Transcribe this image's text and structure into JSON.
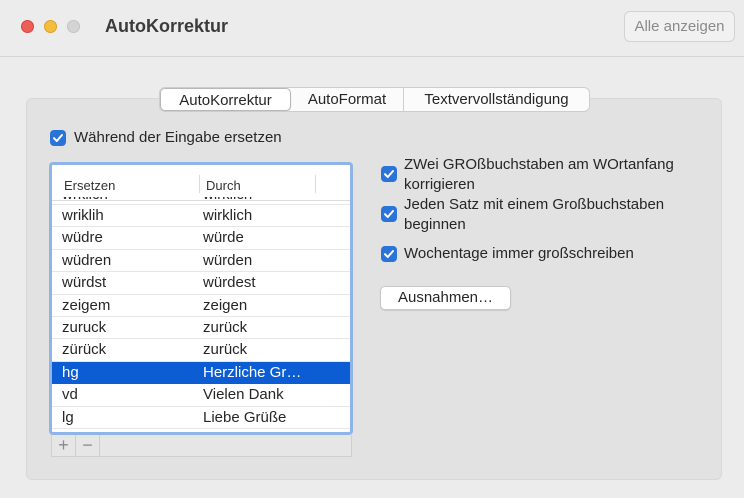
{
  "window": {
    "title": "AutoKorrektur",
    "show_all_label": "Alle anzeigen"
  },
  "tabs": [
    {
      "label": "AutoKorrektur",
      "selected": true
    },
    {
      "label": "AutoFormat",
      "selected": false
    },
    {
      "label": "Textvervollständigung",
      "selected": false
    }
  ],
  "options": {
    "replace_while_typing": {
      "label": "Während der Eingabe ersetzen",
      "checked": true
    },
    "two_capitals": {
      "label_line1": "ZWei GROßbuchstaben am WOrtanfang",
      "label_line2": "korrigieren",
      "checked": true
    },
    "capitalize_sentence": {
      "label_line1": "Jeden Satz mit einem Großbuchstaben",
      "label_line2": "beginnen",
      "checked": true
    },
    "capitalize_weekdays": {
      "label": "Wochentage immer großschreiben",
      "checked": true
    }
  },
  "table": {
    "headers": [
      "Ersetzen",
      "Durch"
    ],
    "partial_row": {
      "replace": "wrklich",
      "with": "wirklich"
    },
    "rows": [
      {
        "replace": "wriklih",
        "with": "wirklich",
        "selected": false
      },
      {
        "replace": "wüdre",
        "with": "würde",
        "selected": false
      },
      {
        "replace": "wüdren",
        "with": "würden",
        "selected": false
      },
      {
        "replace": "würdst",
        "with": "würdest",
        "selected": false
      },
      {
        "replace": "zeigem",
        "with": "zeigen",
        "selected": false
      },
      {
        "replace": "zuruck",
        "with": "zurück",
        "selected": false
      },
      {
        "replace": "zürück",
        "with": "zurück",
        "selected": false
      },
      {
        "replace": "hg",
        "with": "Herzliche Gr…",
        "selected": true
      },
      {
        "replace": "vd",
        "with": "Vielen Dank",
        "selected": false
      },
      {
        "replace": "lg",
        "with": "Liebe Grüße",
        "selected": false
      }
    ]
  },
  "buttons": {
    "add": "+",
    "remove": "−",
    "exceptions": "Ausnahmen…"
  },
  "colors": {
    "accent": "#2a74d9",
    "selection": "#0c5dd3",
    "focus_ring": "#8fb4ea"
  }
}
